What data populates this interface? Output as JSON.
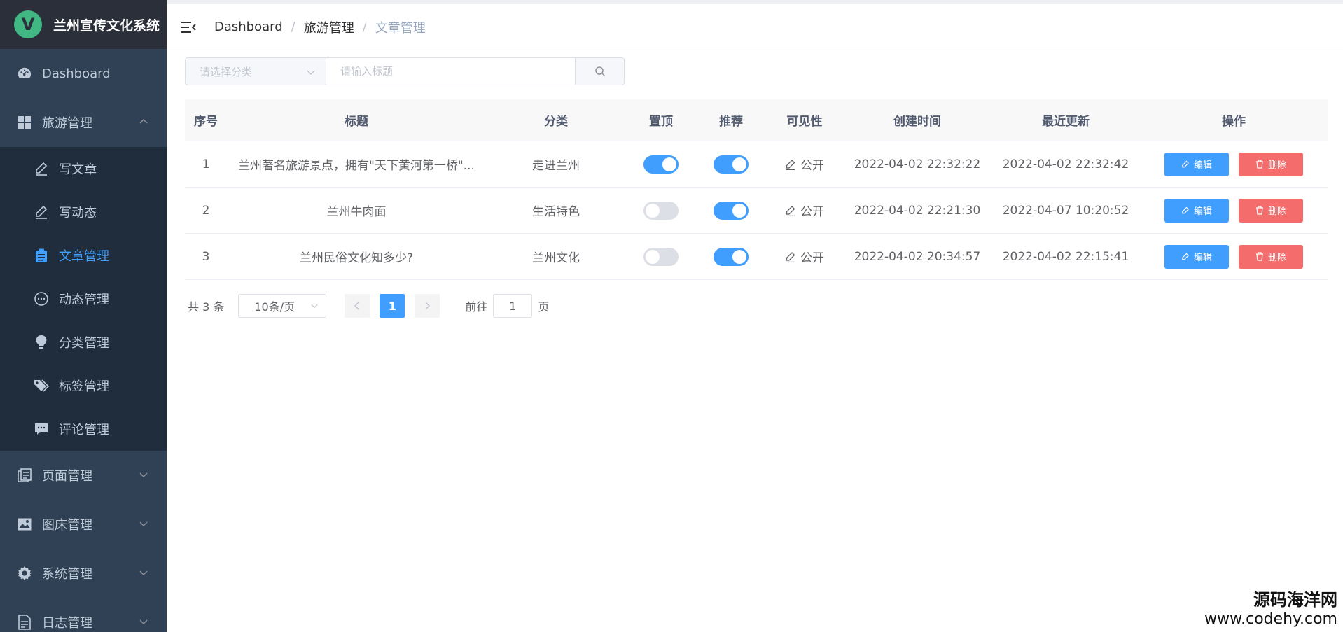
{
  "app": {
    "logo_letter": "V",
    "title": "兰州宣传文化系统"
  },
  "sidebar": {
    "items": [
      {
        "label": "Dashboard",
        "icon": "dashboard-icon"
      },
      {
        "label": "旅游管理",
        "icon": "grid-icon",
        "expanded": true,
        "children": [
          {
            "label": "写文章",
            "icon": "pencil-icon"
          },
          {
            "label": "写动态",
            "icon": "pencil-icon"
          },
          {
            "label": "文章管理",
            "icon": "clipboard-icon",
            "active": true
          },
          {
            "label": "动态管理",
            "icon": "chat-bubble-icon"
          },
          {
            "label": "分类管理",
            "icon": "lightbulb-icon"
          },
          {
            "label": "标签管理",
            "icon": "tag-icon"
          },
          {
            "label": "评论管理",
            "icon": "comment-icon"
          }
        ]
      },
      {
        "label": "页面管理",
        "icon": "pages-icon"
      },
      {
        "label": "图床管理",
        "icon": "image-icon"
      },
      {
        "label": "系统管理",
        "icon": "gear-icon"
      },
      {
        "label": "日志管理",
        "icon": "log-icon"
      }
    ]
  },
  "breadcrumb": {
    "items": [
      "Dashboard",
      "旅游管理",
      "文章管理"
    ],
    "separator": "/"
  },
  "filters": {
    "category_placeholder": "请选择分类",
    "title_placeholder": "请输入标题"
  },
  "table": {
    "headers": {
      "index": "序号",
      "title": "标题",
      "category": "分类",
      "top": "置顶",
      "recommend": "推荐",
      "visibility": "可见性",
      "created": "创建时间",
      "updated": "最近更新",
      "ops": "操作"
    },
    "rows": [
      {
        "index": "1",
        "title": "兰州著名旅游景点，拥有\"天下黄河第一桥\"...",
        "category": "走进兰州",
        "top": true,
        "recommend": true,
        "visibility": "公开",
        "created": "2022-04-02 22:32:22",
        "updated": "2022-04-02 22:32:42"
      },
      {
        "index": "2",
        "title": "兰州牛肉面",
        "category": "生活特色",
        "top": false,
        "recommend": true,
        "visibility": "公开",
        "created": "2022-04-02 22:21:30",
        "updated": "2022-04-07 10:20:52"
      },
      {
        "index": "3",
        "title": "兰州民俗文化知多少?",
        "category": "兰州文化",
        "top": false,
        "recommend": true,
        "visibility": "公开",
        "created": "2022-04-02 20:34:57",
        "updated": "2022-04-02 22:15:41"
      }
    ],
    "edit_label": "编辑",
    "delete_label": "删除"
  },
  "pagination": {
    "total": "共 3 条",
    "page_size": "10条/页",
    "current_page": "1",
    "goto_prefix": "前往",
    "goto_value": "1",
    "goto_suffix": "页"
  },
  "watermark": {
    "cn": "源码海洋网",
    "url": "www.codehy.com"
  },
  "colors": {
    "sidebar_bg": "#304156",
    "submenu_bg": "#1f2d3d",
    "primary": "#409eff",
    "danger": "#f56c6c",
    "logo_green": "#41b883"
  }
}
